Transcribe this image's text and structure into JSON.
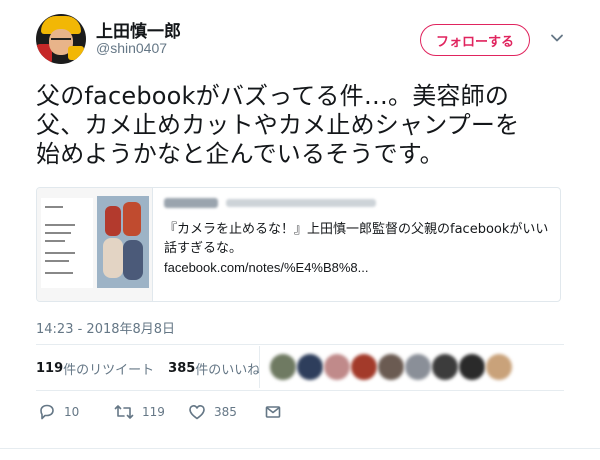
{
  "user": {
    "name": "上田慎一郎",
    "handle": "@shin0407"
  },
  "follow_button": {
    "label": "フォローする"
  },
  "tweet": {
    "lines": [
      "父のfacebookがバズってる件…。美容師の",
      "父、カメ止めカットやカメ止めシャンプーを",
      "始めようかなと企んでいるそうです。"
    ]
  },
  "card": {
    "title_lines": [
      "『カメラを止めるな！』上田慎一郎監督の父親のfacebookがいい",
      "話すぎるな。"
    ],
    "url": "facebook.com/notes/%E4%B8%8..."
  },
  "timestamp": "14:23 - 2018年8月8日",
  "stats": {
    "retweet_count": "119",
    "retweet_label": "件のリツイート",
    "like_count": "385",
    "like_label": "件のいいね"
  },
  "likers_colors": [
    "#6f7a62",
    "#2e3e5c",
    "#c08a8a",
    "#a33a2a",
    "#6b5b52",
    "#8a8f98",
    "#3c3c3c",
    "#2a2a2a",
    "#c9a27a"
  ],
  "actions": {
    "reply_count": "10",
    "retweet_count": "119",
    "like_count": "385"
  },
  "colors": {
    "accent": "#e0245e",
    "secondary_text": "#657786",
    "primary_text": "#14171a"
  },
  "icons": [
    "reply-icon",
    "retweet-icon",
    "heart-icon",
    "message-icon",
    "chevron-down-icon"
  ]
}
